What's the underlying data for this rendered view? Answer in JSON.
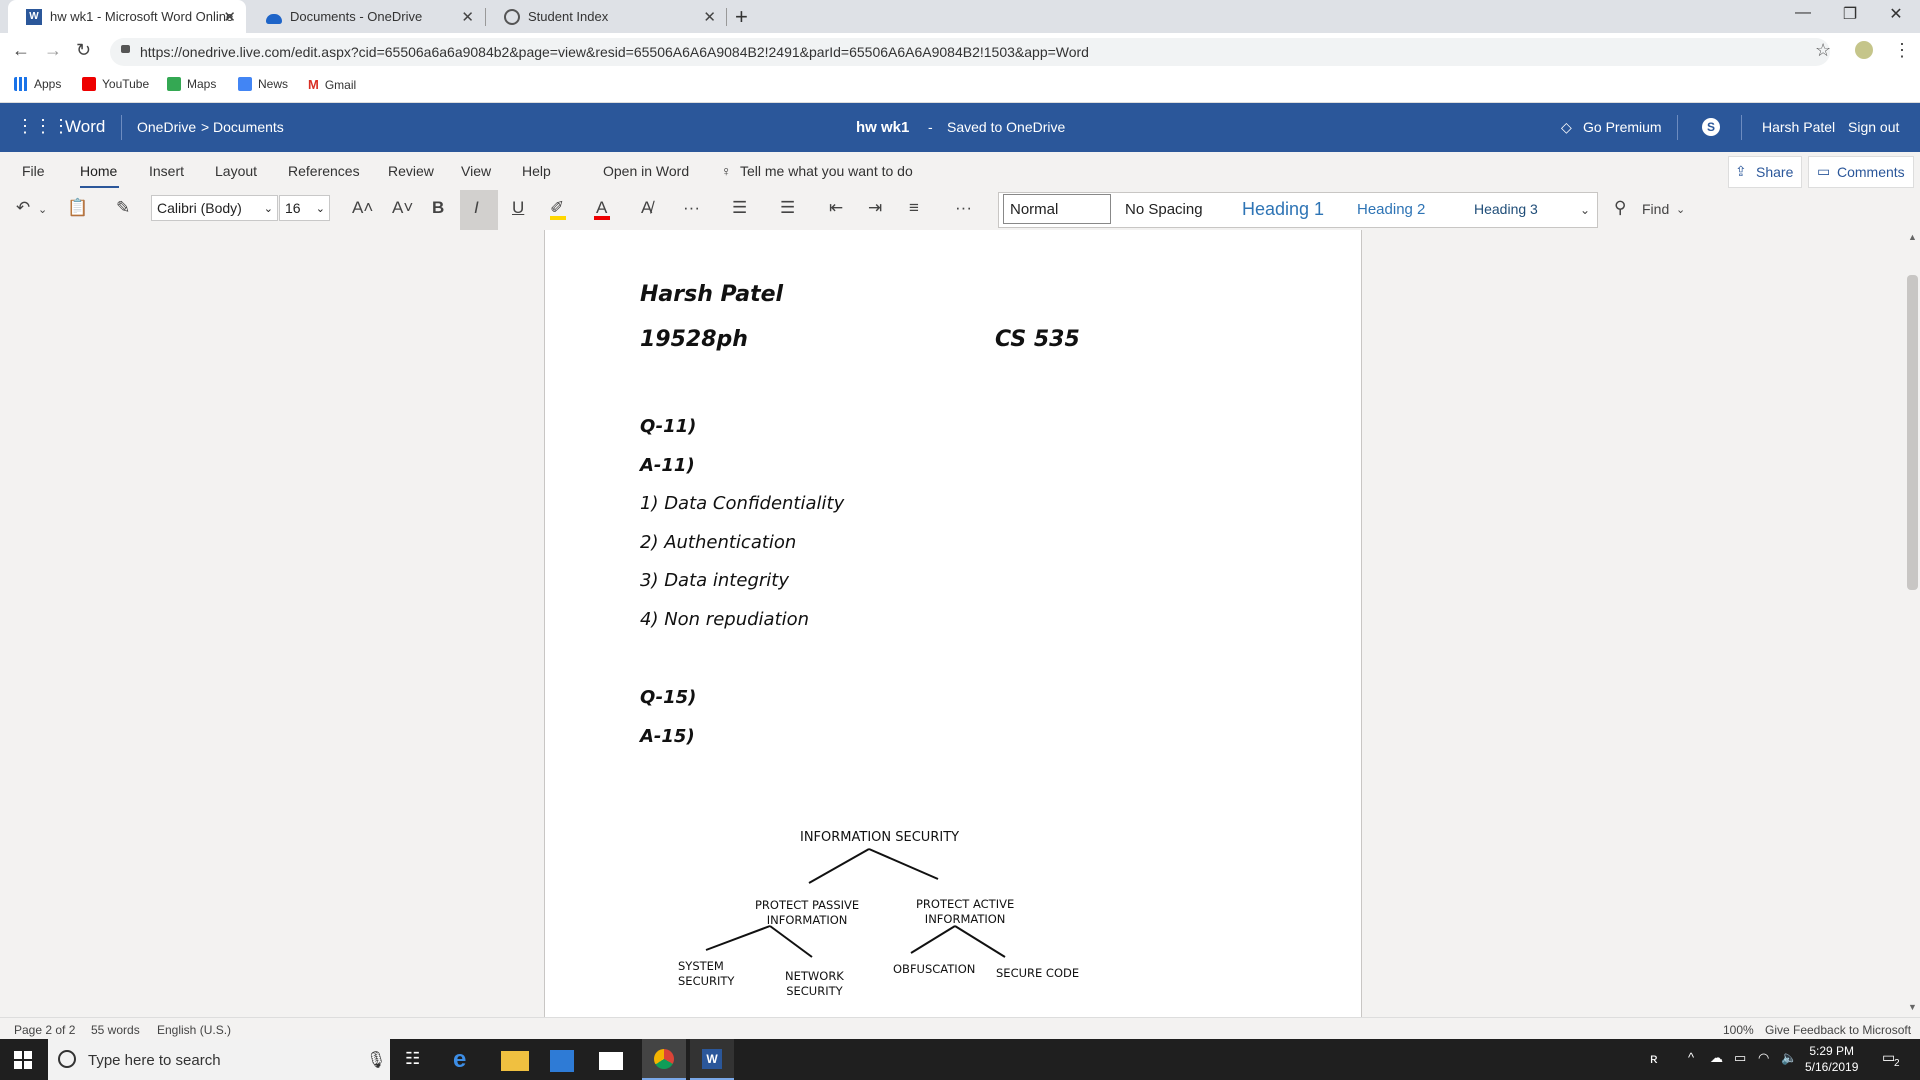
{
  "browser": {
    "tabs": [
      {
        "title": "hw wk1 - Microsoft Word Online",
        "active": true
      },
      {
        "title": "Documents - OneDrive",
        "active": false
      },
      {
        "title": "Student Index",
        "active": false
      }
    ],
    "url": "https://onedrive.live.com/edit.aspx?cid=65506a6a6a9084b2&page=view&resid=65506A6A6A9084B2!2491&parId=65506A6A6A9084B2!1503&app=Word",
    "bookmarks": [
      "Apps",
      "YouTube",
      "Maps",
      "News",
      "Gmail"
    ]
  },
  "word_header": {
    "app_name": "Word",
    "breadcrumb_root": "OneDrive",
    "breadcrumb_sep": ">",
    "breadcrumb_folder": "Documents",
    "doc_title": "hw wk1",
    "title_sep": "-",
    "save_status": "Saved to OneDrive",
    "go_premium": "Go Premium",
    "user_name": "Harsh Patel",
    "sign_out": "Sign out"
  },
  "ribbon": {
    "tabs": [
      "File",
      "Home",
      "Insert",
      "Layout",
      "References",
      "Review",
      "View",
      "Help",
      "Open in Word"
    ],
    "tell_me": "Tell me what you want to do",
    "share": "Share",
    "comments": "Comments",
    "font_name": "Calibri (Body)",
    "font_size": "16",
    "styles": [
      "Normal",
      "No Spacing",
      "Heading 1",
      "Heading 2",
      "Heading 3"
    ],
    "find": "Find"
  },
  "document": {
    "name_line": "Harsh Patel",
    "id_line": "19528ph",
    "course": "CS 535",
    "q11": "Q-11)",
    "a11": "A-11)",
    "answers": [
      "1) Data Confidentiality",
      "2) Authentication",
      "3) Data integrity",
      "4) Non repudiation"
    ],
    "q15": "Q-15)",
    "a15": "A-15)",
    "diagram": {
      "root": "INFORMATION SECURITY",
      "left": "PROTECT PASSIVE\nINFORMATION",
      "right": "PROTECT ACTIVE\nINFORMATION",
      "ll": "SYSTEM\nSECURITY",
      "lr": "NETWORK\nSECURITY",
      "rl": "OBFUSCATION",
      "rr": "SECURE CODE"
    }
  },
  "status_bar": {
    "page": "Page 2 of 2",
    "words": "55 words",
    "language": "English (U.S.)",
    "zoom": "100%",
    "feedback": "Give Feedback to Microsoft"
  },
  "taskbar": {
    "search_placeholder": "Type here to search",
    "time": "5:29 PM",
    "date": "5/16/2019",
    "notification_count": "2"
  },
  "colors": {
    "word_blue": "#2b579a",
    "taskbar": "#1f1f1f"
  }
}
